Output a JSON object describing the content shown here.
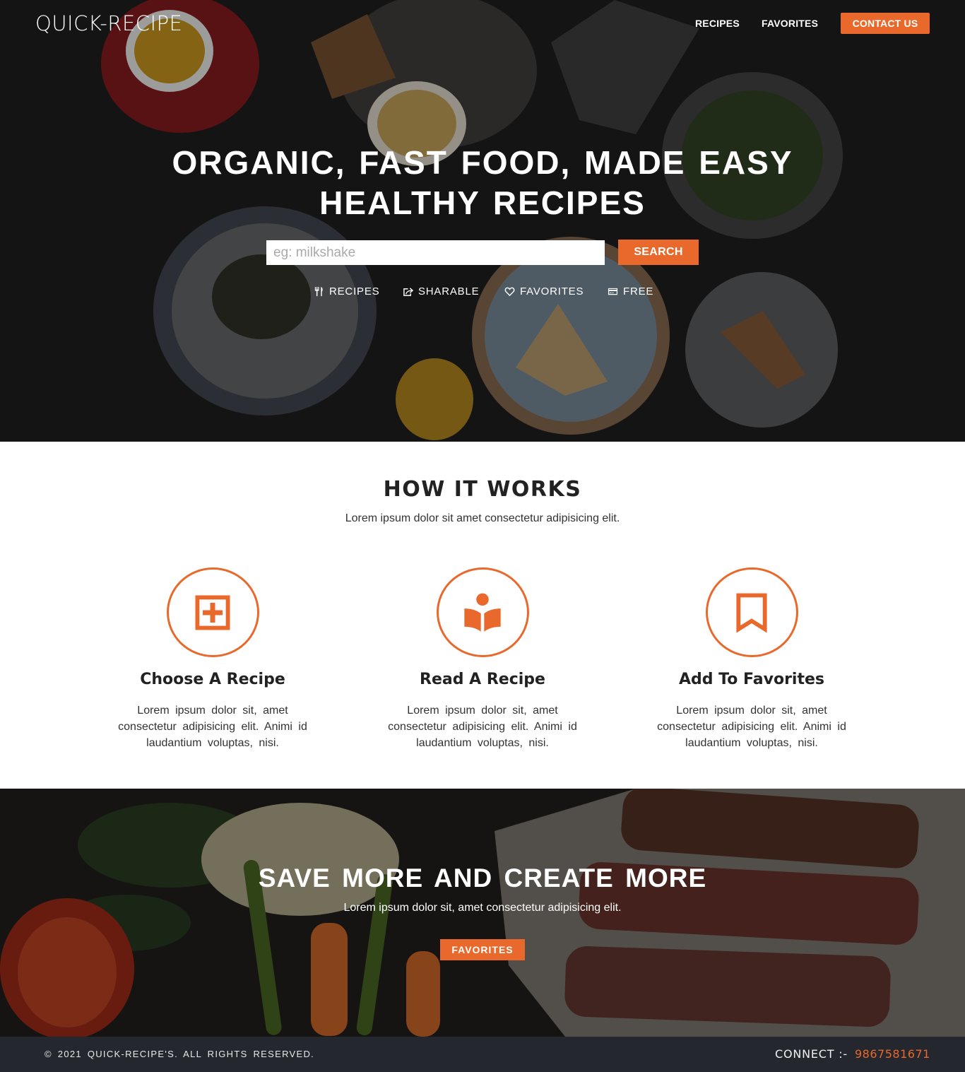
{
  "colors": {
    "accent": "#e8692b",
    "footer_bg": "#24272d",
    "hero_bg": "#1b1b1c"
  },
  "header": {
    "brand": "QUICK-RECIPE",
    "nav": {
      "recipes": "RECIPES",
      "favorites": "FAVORITES",
      "contact": "CONTACT US"
    }
  },
  "hero": {
    "title_line1": "ORGANIC, FAST FOOD, MADE EASY",
    "title_line2": "HEALTHY RECIPES",
    "search": {
      "placeholder": "eg: milkshake",
      "value": "",
      "button": "SEARCH"
    },
    "features": [
      {
        "icon": "utensils-icon",
        "label": "RECIPES"
      },
      {
        "icon": "share-icon",
        "label": "SHARABLE"
      },
      {
        "icon": "heart-icon",
        "label": "FAVORITES"
      },
      {
        "icon": "credit-card-icon",
        "label": "FREE"
      }
    ]
  },
  "how": {
    "title": "HOW IT WORKS",
    "subtitle": "Lorem ipsum dolor sit amet consectetur adipisicing elit.",
    "cards": [
      {
        "icon": "plus-square-icon",
        "title": "Choose A Recipe",
        "text": "Lorem ipsum dolor sit, amet consectetur adipisicing elit. Animi id laudantium voluptas, nisi."
      },
      {
        "icon": "book-reader-icon",
        "title": "Read A Recipe",
        "text": "Lorem ipsum dolor sit, amet consectetur adipisicing elit. Animi id laudantium voluptas, nisi."
      },
      {
        "icon": "bookmark-icon",
        "title": "Add To Favorites",
        "text": "Lorem ipsum dolor sit, amet consectetur adipisicing elit. Animi id laudantium voluptas, nisi."
      }
    ]
  },
  "save": {
    "title": "SAVE MORE AND CREATE MORE",
    "subtitle": "Lorem ipsum dolor sit, amet consectetur adipisicing elit.",
    "button": "FAVORITES"
  },
  "footer": {
    "copyright": "© 2021 QUICK-RECIPE'S. ALL RIGHTS RESERVED.",
    "connect_label": "CONNECT :-",
    "phone": "9867581671"
  }
}
